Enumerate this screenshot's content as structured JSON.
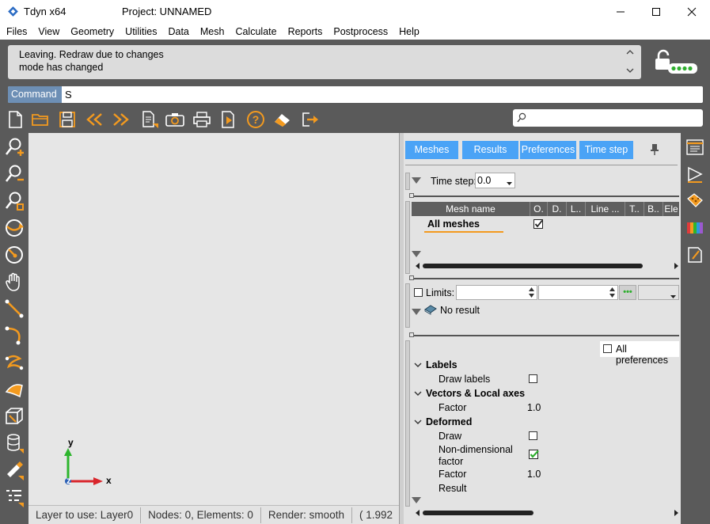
{
  "window": {
    "app_title": "Tdyn x64",
    "project_title": "Project: UNNAMED",
    "minimize_icon": "minimize-icon",
    "maximize_icon": "maximize-icon",
    "close_icon": "close-icon"
  },
  "menu": [
    "Files",
    "View",
    "Geometry",
    "Utilities",
    "Data",
    "Mesh",
    "Calculate",
    "Reports",
    "Postprocess",
    "Help"
  ],
  "messages": {
    "line1": "Leaving. Redraw due to changes",
    "line2": "mode has changed"
  },
  "command": {
    "label": "Command",
    "value": "S"
  },
  "toolbar_icons": [
    "new-file-icon",
    "open-folder-icon",
    "save-icon",
    "previous-icon",
    "next-icon",
    "list-icon",
    "camera-icon",
    "print-icon",
    "export-icon",
    "help-icon",
    "eraser-icon",
    "exit-icon"
  ],
  "search": {
    "placeholder": ""
  },
  "left_toolbar_icons": [
    "zoom-in-icon",
    "zoom-out-icon",
    "zoom-frame-icon",
    "rotate-icon",
    "rotate-center-icon",
    "pan-hand-icon",
    "line-icon",
    "arc-icon",
    "nurbs-line-icon",
    "surface-icon",
    "volume-icon",
    "layers-icon",
    "draw-tool-icon",
    "list-entities-icon"
  ],
  "axes": {
    "y": "y",
    "z": "z",
    "x": "x"
  },
  "status_bar": {
    "layer": "Layer to use: Layer0",
    "counts": "Nodes: 0, Elements: 0",
    "render": "Render: smooth",
    "coords": "( 1.992"
  },
  "panel": {
    "tabs": [
      "Meshes",
      "Results",
      "Preferences",
      "Time step"
    ],
    "pin_icon": "pin-icon",
    "time_step": {
      "label": "Time step:",
      "value": "0.0"
    },
    "mesh_table": {
      "columns": [
        "Mesh name",
        "O.",
        "D.",
        "L..",
        "Line ...",
        "T..",
        "B..",
        "Ele"
      ],
      "rows": [
        {
          "name": "All meshes",
          "O": true
        }
      ]
    },
    "limits": {
      "label": "Limits:",
      "checked": false,
      "min": "",
      "max": "",
      "more_button": "•••"
    },
    "result": {
      "label": "No result",
      "icon": "book-icon"
    },
    "preferences": {
      "all_label": "All preferences",
      "all_checked": false,
      "groups": [
        {
          "title": "Labels",
          "items": [
            {
              "label": "Draw labels",
              "kind": "check",
              "checked": false
            }
          ]
        },
        {
          "title": "Vectors & Local axes",
          "items": [
            {
              "label": "Factor",
              "kind": "value",
              "value": "1.0"
            }
          ]
        },
        {
          "title": "Deformed",
          "items": [
            {
              "label": "Draw",
              "kind": "check",
              "checked": false
            },
            {
              "label": "Non-dimensional factor",
              "kind": "check",
              "checked": true
            },
            {
              "label": "Factor",
              "kind": "value",
              "value": "1.0"
            },
            {
              "label": "Result",
              "kind": "text",
              "value": ""
            }
          ]
        }
      ]
    }
  },
  "right_column_icons": [
    "properties-list-icon",
    "animation-icon",
    "texture-icon",
    "color-palette-icon",
    "notes-icon"
  ],
  "colors": {
    "tab_blue": "#4aa3f6",
    "command_label_bg": "#6d8fb5",
    "toolbar_orange": "#f39a1f",
    "panel_bg": "#e3e3e3",
    "chrome_dark": "#5a5a5a",
    "axis_y": "#2db52d",
    "axis_x": "#d9262c",
    "axis_z": "#2a5fb5"
  }
}
